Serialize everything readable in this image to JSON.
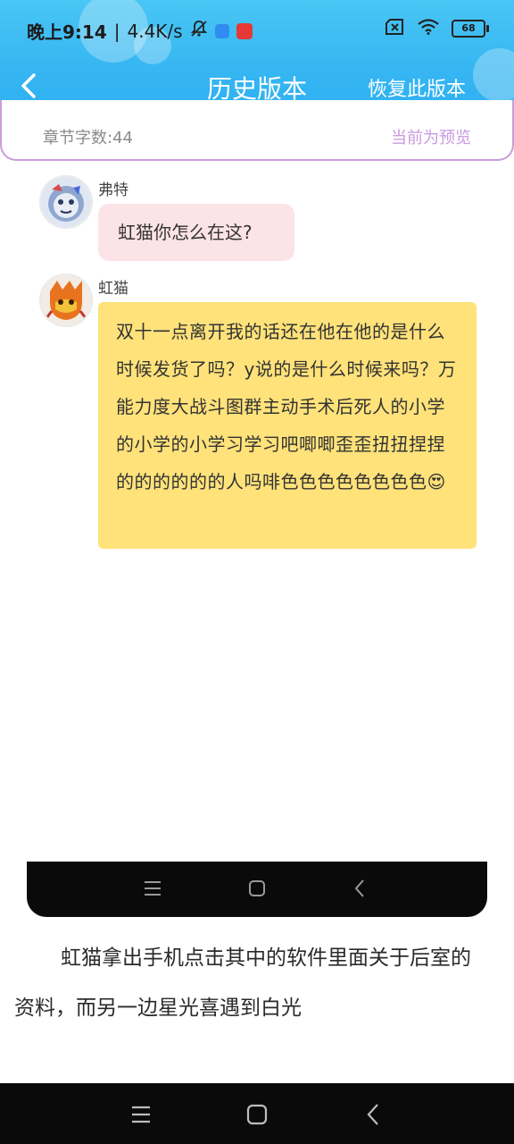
{
  "status_bar": {
    "time": "晚上9:14",
    "separator": "|",
    "speed": "4.4K/s",
    "battery": "68",
    "icons": [
      "mute-bell-icon",
      "app-notification-icon",
      "app-notification-icon",
      "sim-off-icon",
      "wifi-icon",
      "battery-icon"
    ],
    "app_colors": [
      "#2f8cf0",
      "#e53935"
    ]
  },
  "nav": {
    "title": "历史版本",
    "restore_label": "恢复此版本",
    "back_icon": "chevron-left-icon"
  },
  "info": {
    "word_count": "章节字数:44",
    "preview": "当前为预览"
  },
  "chat": {
    "messages": [
      {
        "speaker": "弗特",
        "text": "虹猫你怎么在这?",
        "bubble_color": "#fbe3e8"
      },
      {
        "speaker": "虹猫",
        "text": "双十一点离开我的话还在他在他的是什么时候发货了吗？y说的是什么时候来吗？万能力度大战斗图群主动手术后死人的小学的小学的小学习学习吧唧唧歪歪扭扭捏捏的的的的的的人吗啡色色色色色色色色😍",
        "bubble_color": "#ffe27a"
      }
    ]
  },
  "story": {
    "text": "虹猫拿出手机点击其中的软件里面关于后室的资料，而另一边星光喜遇到白光"
  },
  "theme": {
    "header_blue": "#36b6f2",
    "accent_purple": "#c79ae0"
  }
}
